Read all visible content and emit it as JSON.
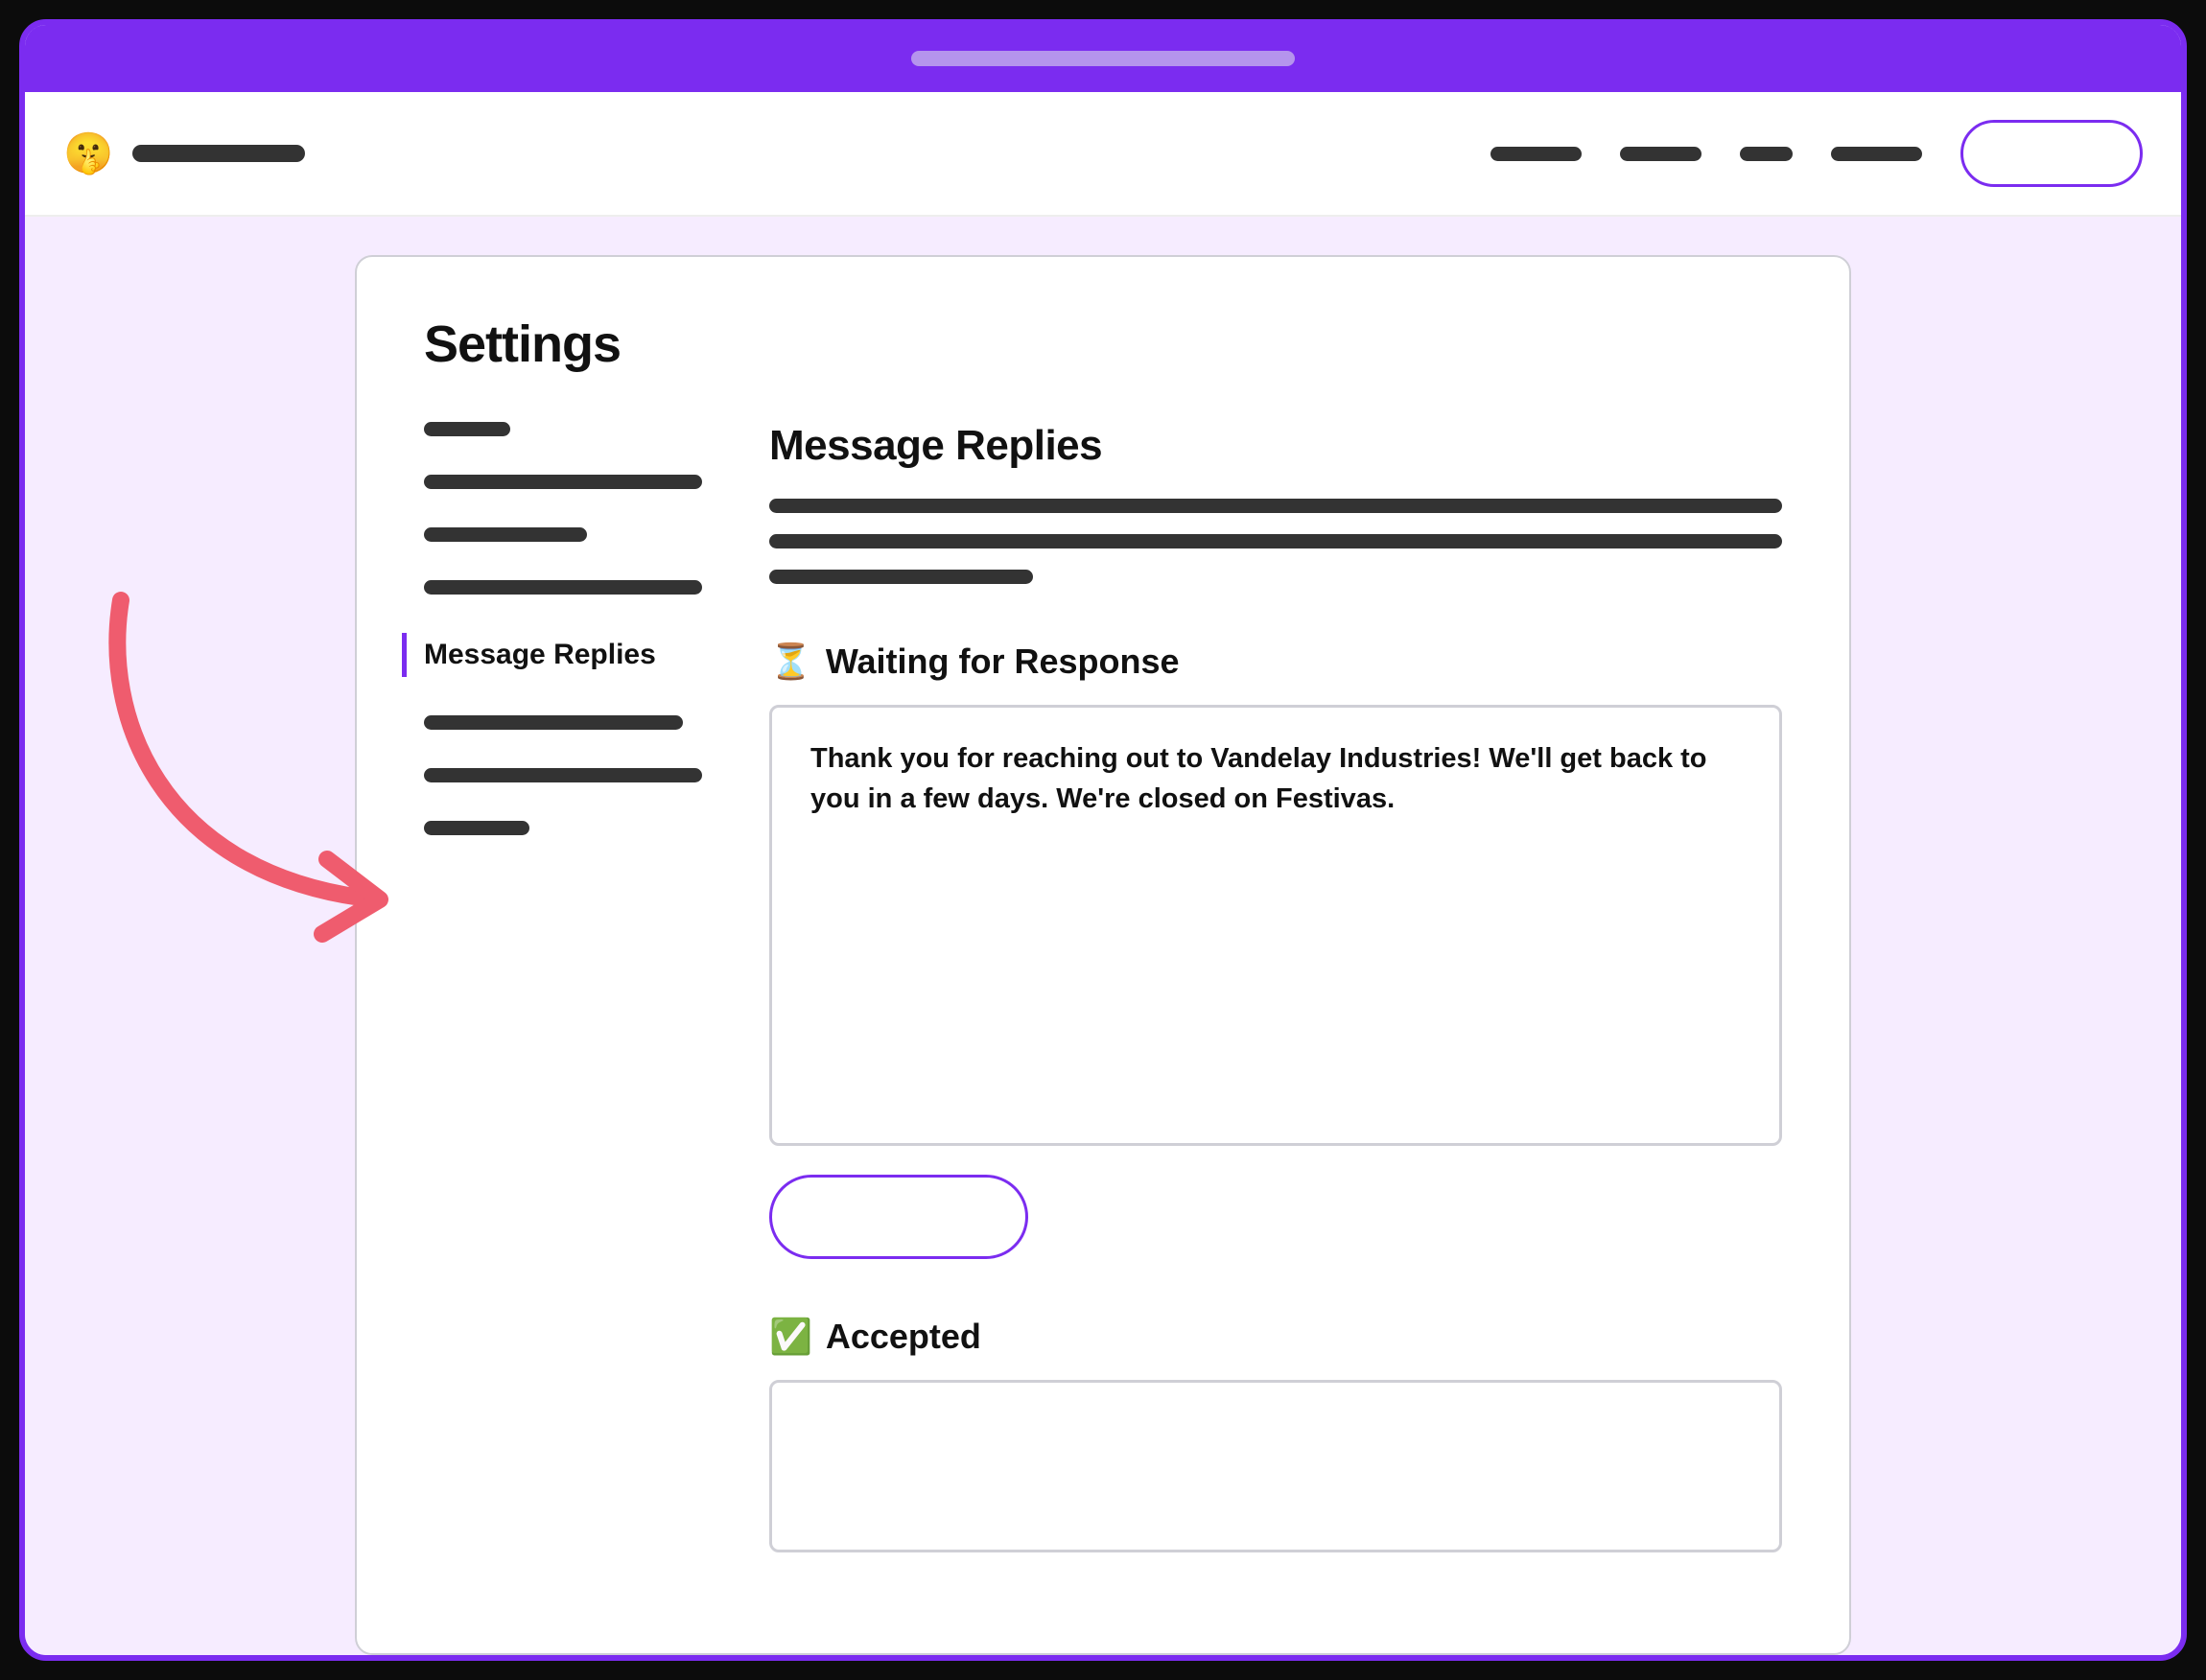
{
  "brand": {
    "emoji": "🤫"
  },
  "settings": {
    "title": "Settings"
  },
  "sidebar": {
    "active_label": "Message Replies"
  },
  "main": {
    "title": "Message Replies",
    "sections": [
      {
        "icon": "⏳",
        "heading": "Waiting for Response",
        "body": "Thank you for reaching out to Vandelay Industries! We'll get back to you in a few days. We're closed on Festivas."
      },
      {
        "icon": "✅",
        "heading": "Accepted",
        "body": ""
      }
    ]
  }
}
